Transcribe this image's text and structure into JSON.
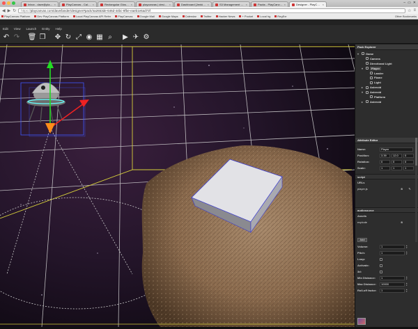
{
  "browser": {
    "tabs": [
      {
        "label": "Inbox - dave@playcanv",
        "active": false
      },
      {
        "label": "PlayCanvas - Calendar",
        "active": false
      },
      {
        "label": "Rectangular Glossy Web",
        "active": false
      },
      {
        "label": "playcanvas | designer",
        "active": false
      },
      {
        "label": "Dashboard [Jenkins]",
        "active": false
      },
      {
        "label": "S3 Management Conso",
        "active": false
      },
      {
        "label": "Packs - PlayCanvas",
        "active": false
      },
      {
        "label": "Designer - PlayCanvas",
        "active": true
      }
    ],
    "url_proto": "https://",
    "url": "playcanvas.com/dave/lander/designer#pack/4a2653de-646d-44bc-8fbe-eaeb1e6ad73f",
    "bookmarks": [
      "PlayCanvas Platform",
      "Dev PlayCanvas Platform",
      "Local PlayCanvas API Refer",
      "PlayCanvas",
      "Google Mail",
      "Google Maps",
      "Calendar",
      "Twitter",
      "Hacker News",
      "+ Pocket",
      "Local hg",
      "RegExr"
    ],
    "other_bookmarks": "Other Bookmarks"
  },
  "menu": [
    "Edit",
    "View",
    "Launch",
    "Entity",
    "Help"
  ],
  "toolbar": [
    {
      "name": "undo-icon",
      "glyph": "↶"
    },
    {
      "name": "redo-icon",
      "glyph": "↷"
    },
    {
      "name": "delete-icon",
      "glyph": "🗑"
    },
    {
      "name": "duplicate-icon",
      "glyph": "❐"
    },
    {
      "name": "translate-icon",
      "glyph": "✥"
    },
    {
      "name": "rotate-icon",
      "glyph": "↻"
    },
    {
      "name": "scale-icon",
      "glyph": "⤢"
    },
    {
      "name": "world-space-icon",
      "glyph": "◉"
    },
    {
      "name": "frame-selection-icon",
      "glyph": "▦"
    },
    {
      "name": "zoom-icon",
      "glyph": "⌕"
    },
    {
      "name": "play-icon",
      "glyph": "▶"
    },
    {
      "name": "publish-icon",
      "glyph": "✈"
    },
    {
      "name": "settings-icon",
      "glyph": "⚙"
    }
  ],
  "pack_explorer": {
    "title": "Pack Explorer",
    "items": [
      {
        "label": "Game",
        "indent": 0,
        "twist": "▾",
        "selected": false
      },
      {
        "label": "Camera",
        "indent": 1,
        "twist": "",
        "selected": false
      },
      {
        "label": "Directional Light",
        "indent": 1,
        "twist": "",
        "selected": false
      },
      {
        "label": "Player",
        "indent": 1,
        "twist": "▾",
        "selected": true
      },
      {
        "label": "Lander",
        "indent": 2,
        "twist": "",
        "selected": false
      },
      {
        "label": "Flame",
        "indent": 2,
        "twist": "",
        "selected": false
      },
      {
        "label": "Light",
        "indent": 2,
        "twist": "",
        "selected": false
      },
      {
        "label": "Asteroid",
        "indent": 1,
        "twist": "▸",
        "selected": false
      },
      {
        "label": "Asteroid",
        "indent": 1,
        "twist": "▾",
        "selected": false
      },
      {
        "label": "Platform",
        "indent": 2,
        "twist": "",
        "selected": false
      },
      {
        "label": "Asteroid",
        "indent": 1,
        "twist": "▸",
        "selected": false
      }
    ]
  },
  "attribute_editor": {
    "title": "Attribute Editor",
    "name_label": "Name:",
    "name_value": "Player",
    "position_label": "Position:",
    "position": [
      "3.39",
      "12.0",
      "0"
    ],
    "rotation_label": "Rotation:",
    "rotation": [
      "0",
      "0",
      "0"
    ],
    "scale_label": "Scale:",
    "scale": [
      "1",
      "1",
      "1"
    ],
    "script_section": "script",
    "urls_label": "URLs",
    "script_url": "player.js",
    "audio_section": "audiosource",
    "assets_label": "Assets",
    "asset": "explode",
    "add_label": "Add",
    "volume_label": "Volume:",
    "volume": "1",
    "pitch_label": "Pitch:",
    "pitch": "1",
    "loop_label": "Loop:",
    "activate_label": "Activate:",
    "3d_label": "3d:",
    "min_distance_label": "Min Distance:",
    "min_distance": "1",
    "max_distance_label": "Max Distance:",
    "max_distance": "10000",
    "rolloff_label": "Roll-off factor:",
    "rolloff": "1"
  }
}
